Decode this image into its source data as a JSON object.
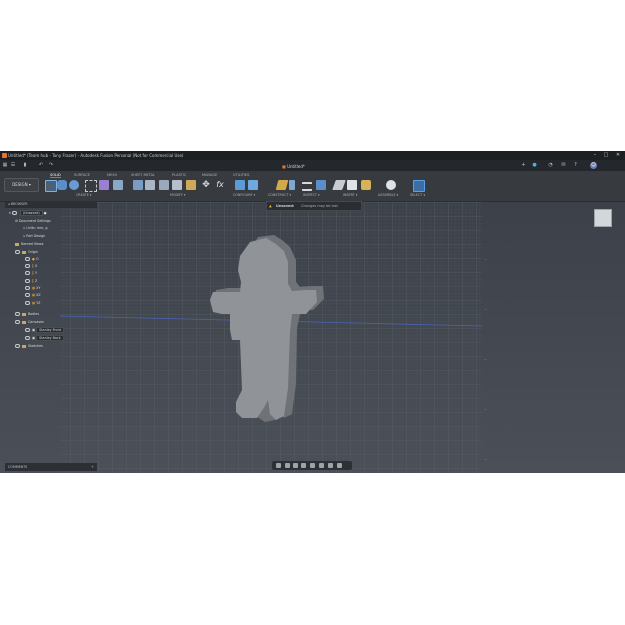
{
  "window": {
    "title": "Untitled* (Team hub - Tony Frazer) - Autodesk Fusion Personal (Not for Commercial Use)",
    "controls": [
      "–",
      "□",
      "✕"
    ]
  },
  "tabbar": {
    "document_tab": "Untitled*"
  },
  "toolbar": {
    "design_label": "DESIGN ▾",
    "workspace_tabs": [
      "SOLID",
      "SURFACE",
      "MESH",
      "SHEET METAL",
      "PLASTIC",
      "MANAGE",
      "UTILITIES"
    ],
    "active_tab": "SOLID",
    "groups": [
      "CREATE ▾",
      "MODIFY ▾",
      "CONFIGURE ▾",
      "CONSTRUCT ▾",
      "INSPECT ▾",
      "INSERT ▾",
      "ASSEMBLE ▾",
      "SELECT ▾"
    ]
  },
  "warning": {
    "status": "Unsaved:",
    "message": "Changes may be lost"
  },
  "browser": {
    "header": "BROWSER",
    "root": "(Unsaved)",
    "items": {
      "document_settings": "Document Settings",
      "units": "Units: mm, g",
      "part_design": "Part Design",
      "named_views": "Named Views",
      "origin": "Origin",
      "o": "O",
      "x": "X",
      "y": "Y",
      "z": "Z",
      "xy": "XY",
      "xz": "XZ",
      "yz": "YZ",
      "bodies": "Bodies",
      "canvases": "Canvases",
      "stanley_front": "Stanley Front",
      "stanley_back": "Stanley Back",
      "sketches": "Sketches"
    }
  },
  "comments": {
    "label": "COMMENTS"
  },
  "colors": {
    "accent": "#3b8ee0",
    "viewport": "#474c54",
    "toolbar": "#373b40",
    "model": "#8e9196",
    "warning": "#f0b429"
  }
}
